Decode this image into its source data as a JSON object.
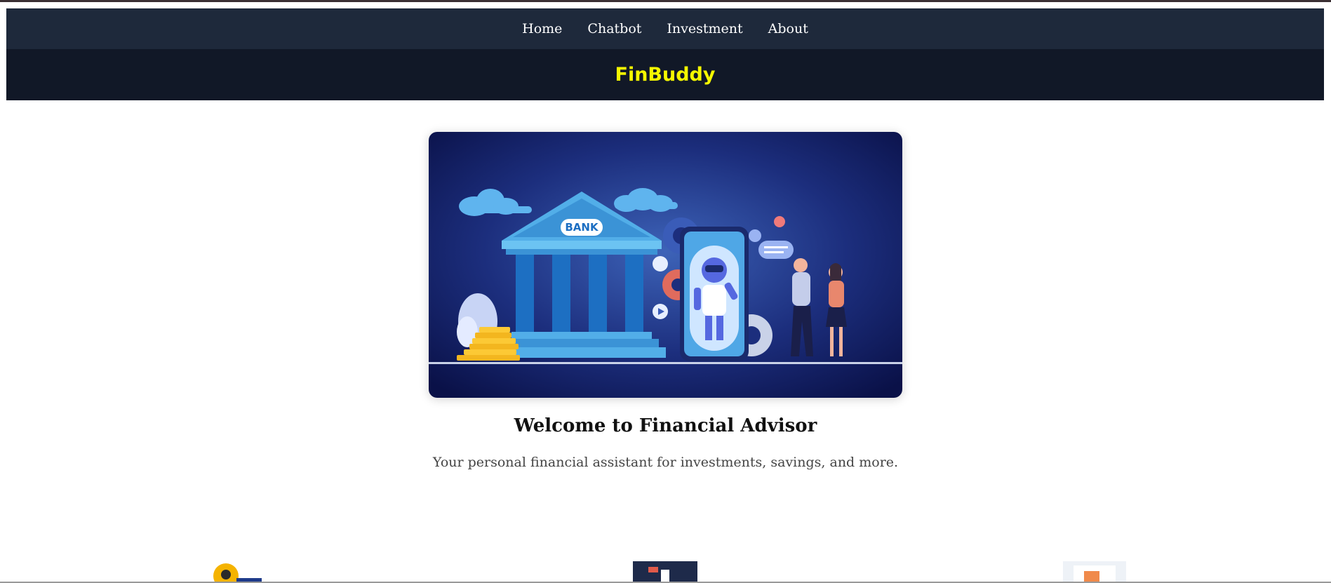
{
  "nav": {
    "items": [
      "Home",
      "Chatbot",
      "Investment",
      "About"
    ]
  },
  "brand": {
    "name": "FinBuddy",
    "color": "#f5f800"
  },
  "hero": {
    "bank_sign": "BANK",
    "illustration": "bank-building-robot-phone-couple-illustration"
  },
  "main": {
    "title": "Welcome to Financial Advisor",
    "subtitle": "Your personal financial assistant for investments, savings, and more."
  },
  "colors": {
    "navbar": "#1e293b",
    "brandbar": "#111827",
    "hero_bg": "#0f1a5c"
  }
}
